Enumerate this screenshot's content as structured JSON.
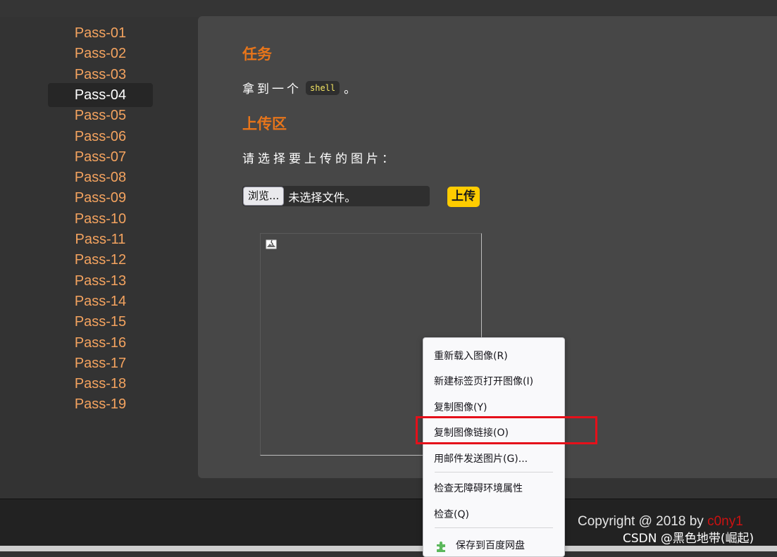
{
  "sidebar": {
    "items": [
      {
        "label": "Pass-01"
      },
      {
        "label": "Pass-02"
      },
      {
        "label": "Pass-03"
      },
      {
        "label": "Pass-04",
        "active": true
      },
      {
        "label": "Pass-05"
      },
      {
        "label": "Pass-06"
      },
      {
        "label": "Pass-07"
      },
      {
        "label": "Pass-08"
      },
      {
        "label": "Pass-09"
      },
      {
        "label": "Pass-10"
      },
      {
        "label": "Pass-11"
      },
      {
        "label": "Pass-12"
      },
      {
        "label": "Pass-13"
      },
      {
        "label": "Pass-14"
      },
      {
        "label": "Pass-15"
      },
      {
        "label": "Pass-16"
      },
      {
        "label": "Pass-17"
      },
      {
        "label": "Pass-18"
      },
      {
        "label": "Pass-19"
      }
    ]
  },
  "main": {
    "task_heading": "任务",
    "task_prefix": "拿到一个",
    "task_code": "shell",
    "task_suffix": "。",
    "upload_heading": "上传区",
    "select_label": "请选择要上传的图片：",
    "browse_label": "浏览...",
    "file_status": "未选择文件。",
    "upload_button": "上传"
  },
  "context_menu": {
    "items": [
      {
        "label": "重新载入图像(R)"
      },
      {
        "label": "新建标签页打开图像(I)"
      },
      {
        "label": "复制图像(Y)"
      },
      {
        "label": "复制图像链接(O)",
        "highlighted": true
      },
      {
        "label": "用邮件发送图片(G)..."
      },
      {
        "label": "检查无障碍环境属性"
      },
      {
        "label": "检查(Q)"
      },
      {
        "label": "保存到百度网盘"
      }
    ]
  },
  "footer": {
    "copyright_prefix": "Copyright @ 2018 by ",
    "author": "c0ny1"
  },
  "watermark": "CSDN @黑色地带(崛起)",
  "colors": {
    "nav_link": "#f4a35f",
    "heading": "#e8751a",
    "upload_button_bg": "#ffcc00",
    "highlight_border": "#e5101a",
    "author": "#cc1111"
  }
}
